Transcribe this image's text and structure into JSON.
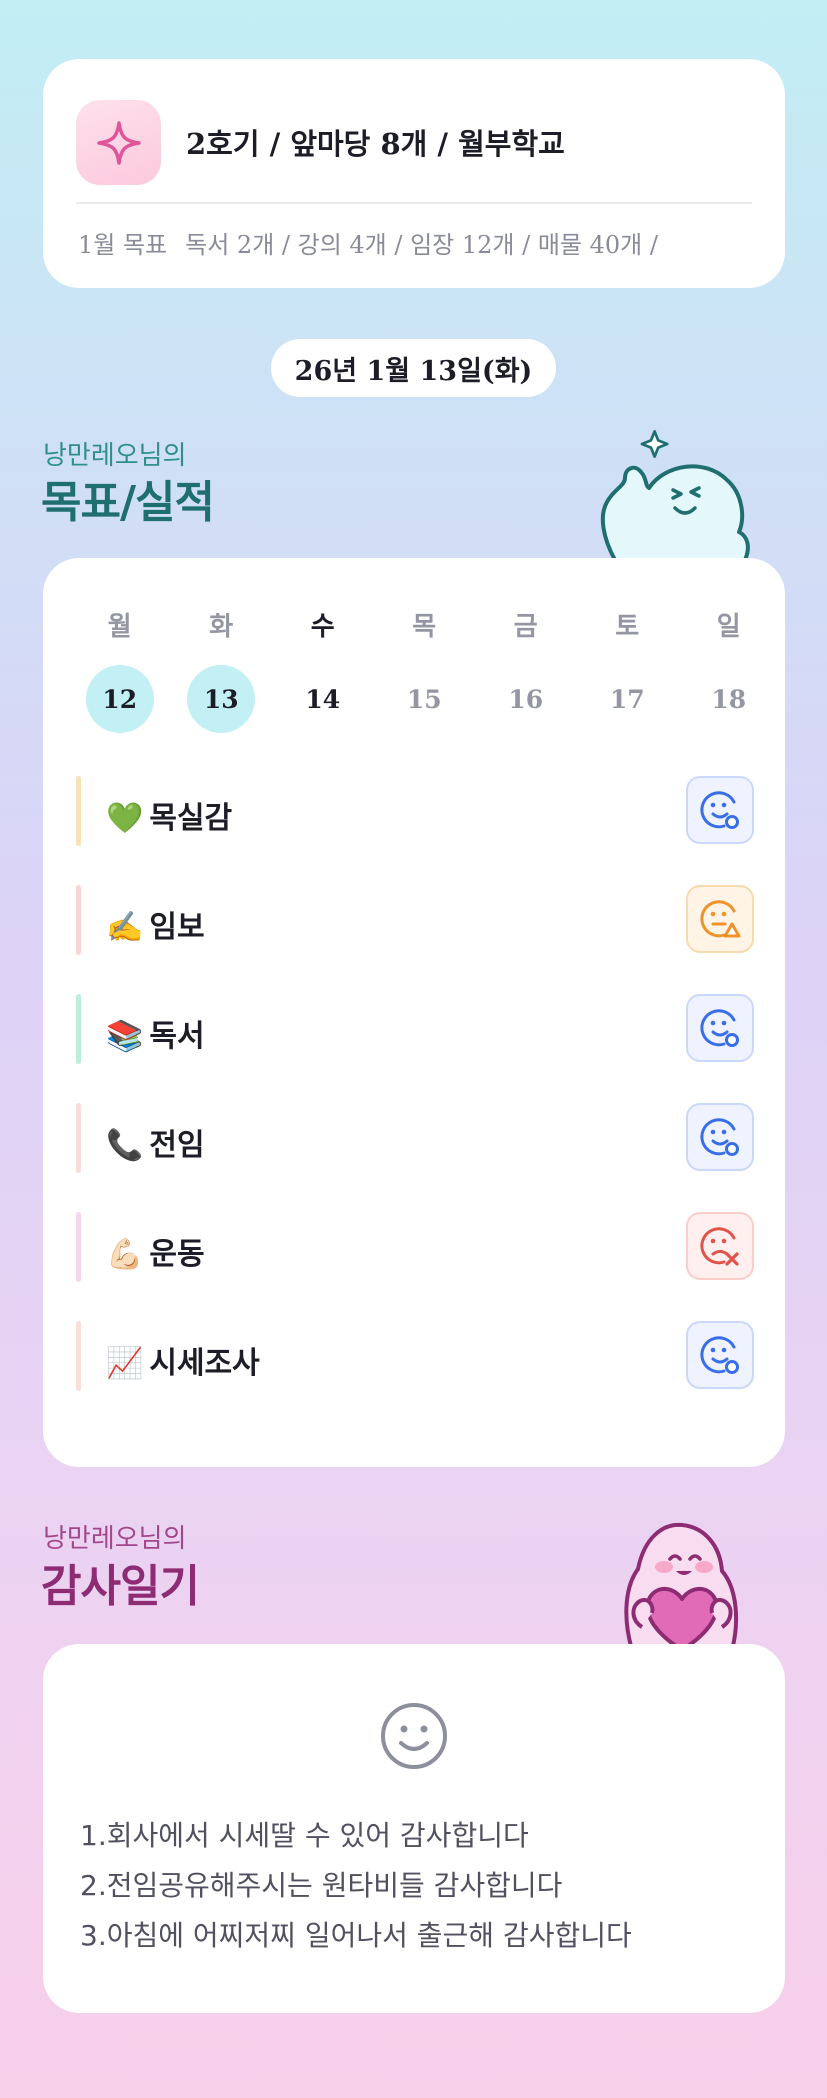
{
  "header": {
    "title": "2호기 / 앞마당 8개 / 월부학교",
    "goal_label": "1월 목표",
    "goal_text": "독서 2개 / 강의 4개 / 임장 12개 / 매물 40개 /"
  },
  "date": "26년 1월 13일(화)",
  "goal_section": {
    "subtitle": "낭만레오님의",
    "title": "목표/실적"
  },
  "week": {
    "days": [
      {
        "name": "월",
        "num": "12",
        "state": "done"
      },
      {
        "name": "화",
        "num": "13",
        "state": "done"
      },
      {
        "name": "수",
        "num": "14",
        "state": "today"
      },
      {
        "name": "목",
        "num": "15",
        "state": "future"
      },
      {
        "name": "금",
        "num": "16",
        "state": "future"
      },
      {
        "name": "토",
        "num": "17",
        "state": "future"
      },
      {
        "name": "일",
        "num": "18",
        "state": "future"
      }
    ]
  },
  "habits": [
    {
      "emoji": "💚",
      "label": "목실감",
      "status": "ok",
      "bar_color": "#f9e3b6"
    },
    {
      "emoji": "✍️",
      "label": "임보",
      "status": "warn",
      "bar_color": "#fbd5d5"
    },
    {
      "emoji": "📚",
      "label": "독서",
      "status": "ok",
      "bar_color": "#b9f0d6"
    },
    {
      "emoji": "📞",
      "label": "전임",
      "status": "ok",
      "bar_color": "#fbdcdc"
    },
    {
      "emoji": "💪🏻",
      "label": "운동",
      "status": "fail",
      "bar_color": "#f6d6ee"
    },
    {
      "emoji": "📈",
      "label": "시세조사",
      "status": "ok",
      "bar_color": "#fbe0d8"
    }
  ],
  "status_colors": {
    "ok": "#3a6ee8",
    "warn": "#f0922a",
    "fail": "#e0534a"
  },
  "thanks_section": {
    "subtitle": "낭만레오님의",
    "title": "감사일기"
  },
  "thanks_items": [
    "1.회사에서 시세딸 수 있어 감사합니다",
    "2.전임공유해주시는 원타비들 감사합니다",
    "3.아침에 어찌저찌 일어나서 출근해 감사합니다"
  ]
}
